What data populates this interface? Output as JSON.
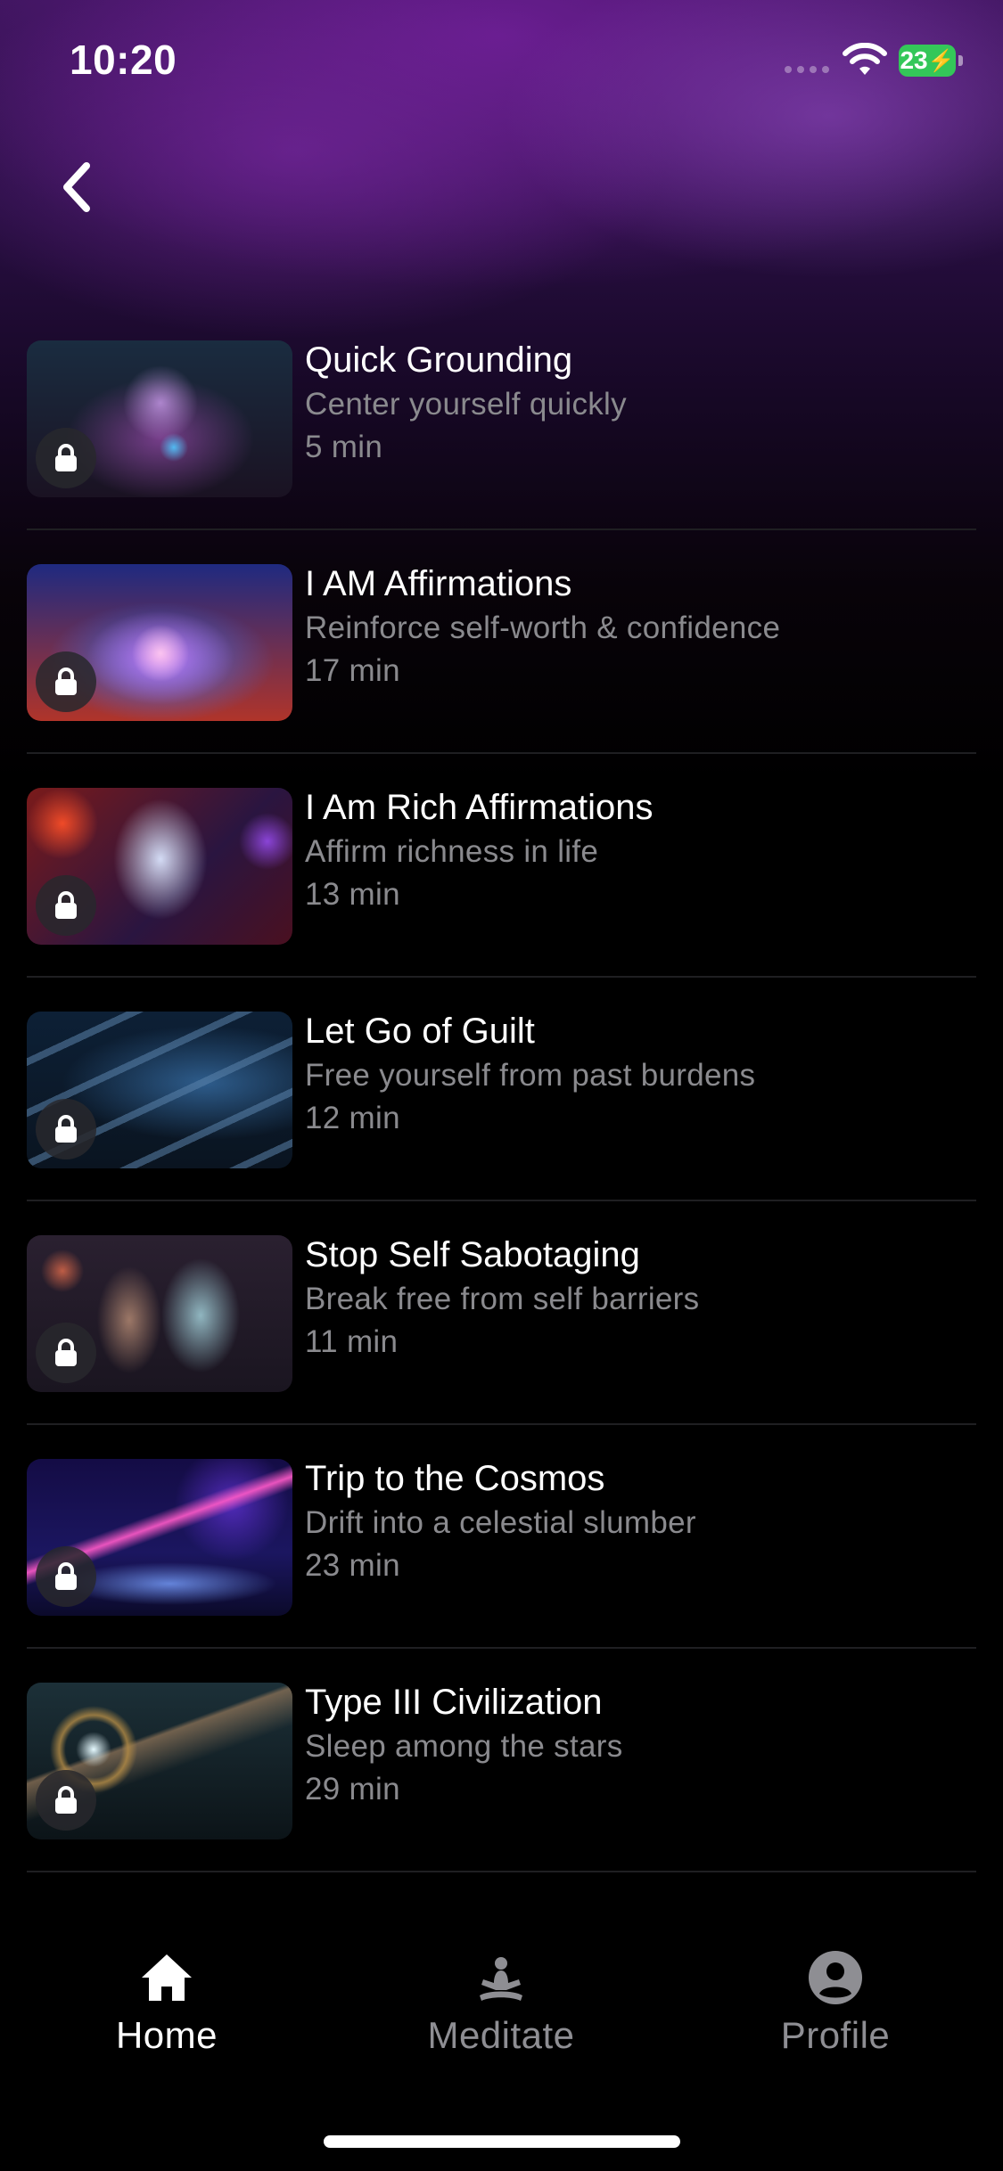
{
  "status_bar": {
    "time": "10:20",
    "battery": "23",
    "battery_color": "#34c759"
  },
  "navigation": {
    "back_icon": "chevron-left-icon"
  },
  "sessions": [
    {
      "title": "Quick Grounding",
      "subtitle": "Center yourself quickly",
      "duration": "5 min",
      "locked": true,
      "thumbnail": "tree-of-life"
    },
    {
      "title": "I AM Affirmations",
      "subtitle": "Reinforce self-worth & confidence",
      "duration": "17 min",
      "locked": true,
      "thumbnail": "lotus"
    },
    {
      "title": "I Am Rich Affirmations",
      "subtitle": "Affirm richness in life",
      "duration": "13 min",
      "locked": true,
      "thumbnail": "crystal"
    },
    {
      "title": "Let Go of Guilt",
      "subtitle": "Free yourself from past burdens",
      "duration": "12 min",
      "locked": true,
      "thumbnail": "chain"
    },
    {
      "title": "Stop Self Sabotaging",
      "subtitle": "Break free from self barriers",
      "duration": "11 min",
      "locked": true,
      "thumbnail": "masks"
    },
    {
      "title": "Trip to the Cosmos",
      "subtitle": "Drift into a celestial slumber",
      "duration": "23 min",
      "locked": true,
      "thumbnail": "comets"
    },
    {
      "title": "Type III Civilization",
      "subtitle": "Sleep among the stars",
      "duration": "29 min",
      "locked": true,
      "thumbnail": "space-station"
    }
  ],
  "tab_bar": {
    "active": "Home",
    "tabs": [
      {
        "label": "Home",
        "icon": "home-icon"
      },
      {
        "label": "Meditate",
        "icon": "meditate-icon"
      },
      {
        "label": "Profile",
        "icon": "profile-icon"
      }
    ]
  }
}
